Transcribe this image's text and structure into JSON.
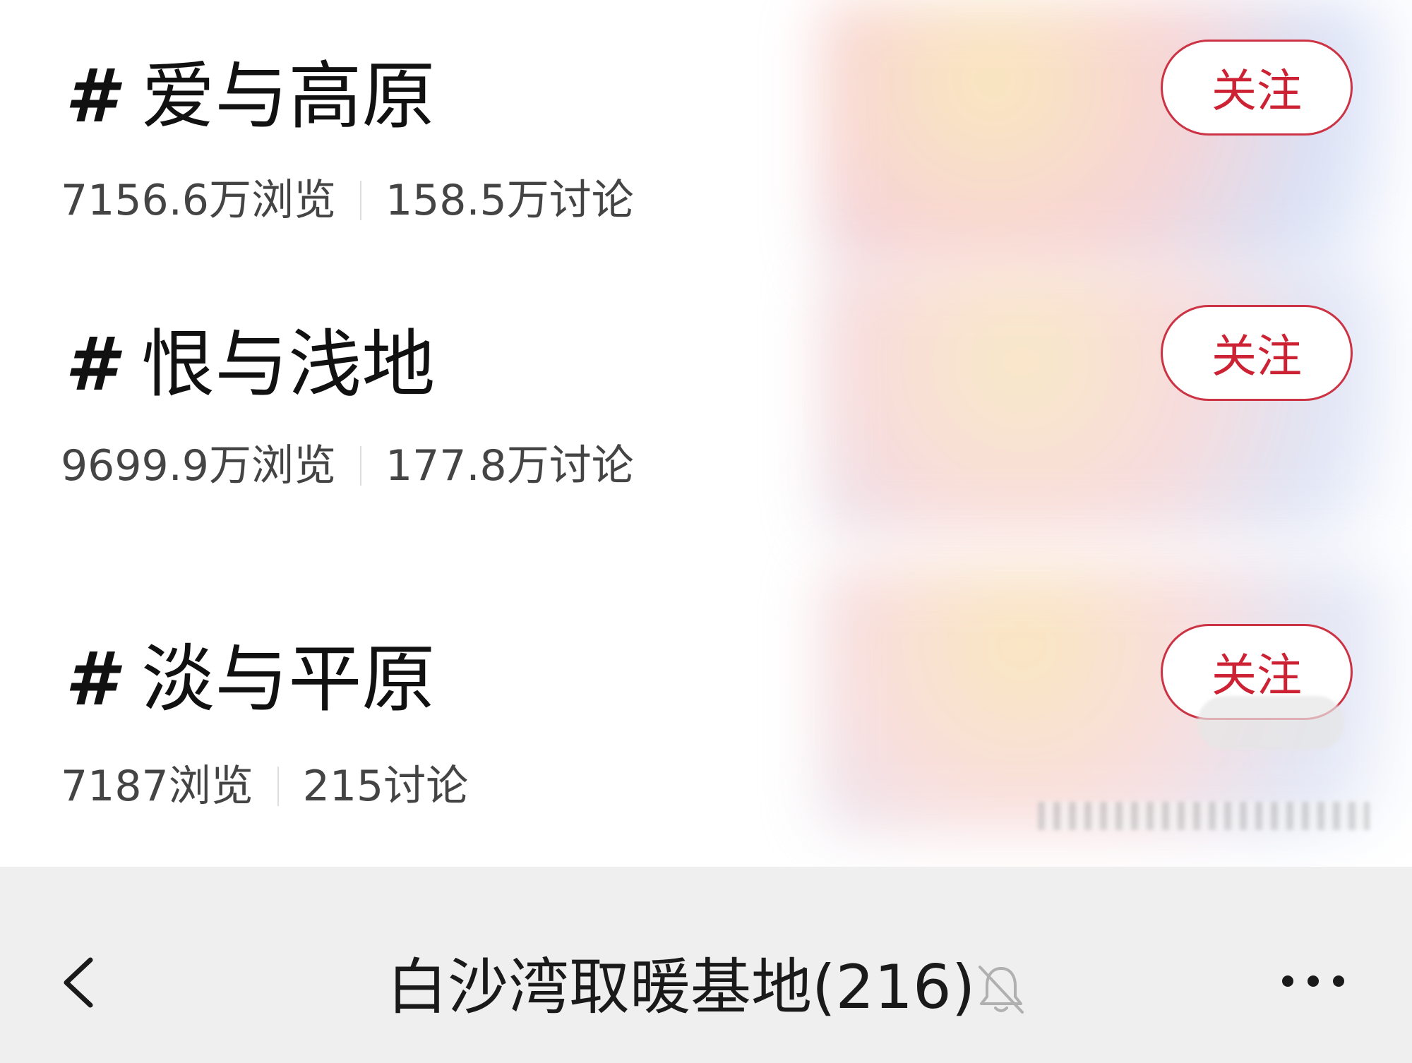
{
  "topics": [
    {
      "hash": "#",
      "title": "爱与高原",
      "views": "7156.6万浏览",
      "discussions": "158.5万讨论",
      "follow_label": "关注"
    },
    {
      "hash": "#",
      "title": "恨与浅地",
      "views": "9699.9万浏览",
      "discussions": "177.8万讨论",
      "follow_label": "关注"
    },
    {
      "hash": "#",
      "title": "淡与平原",
      "views": "7187浏览",
      "discussions": "215讨论",
      "follow_label": "关注"
    }
  ],
  "bottom_bar": {
    "title": "白沙湾取暖基地(216)",
    "back_icon": "chevron-left-icon",
    "mute_icon": "bell-off-icon",
    "more_icon": "more-horizontal-icon"
  },
  "colors": {
    "accent": "#cc2233",
    "bottom_bar_bg": "#efefef"
  }
}
